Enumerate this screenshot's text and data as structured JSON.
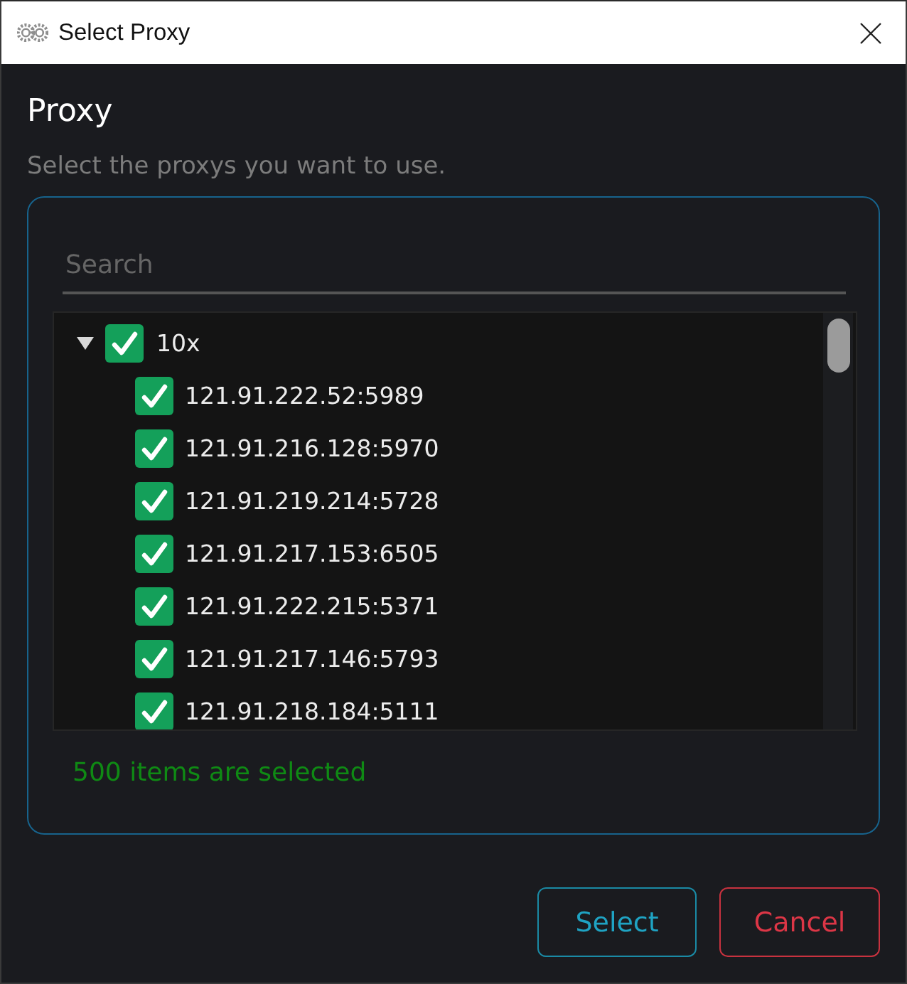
{
  "window": {
    "title": "Select Proxy"
  },
  "header": {
    "title": "Proxy",
    "subtitle": "Select the proxys you want to use."
  },
  "search": {
    "placeholder": "Search"
  },
  "tree": [
    {
      "label": "10x",
      "expanded": true,
      "checked": true,
      "children": [
        {
          "label": "121.91.222.52:5989",
          "checked": true
        },
        {
          "label": "121.91.216.128:5970",
          "checked": true
        },
        {
          "label": "121.91.219.214:5728",
          "checked": true
        },
        {
          "label": "121.91.217.153:6505",
          "checked": true
        },
        {
          "label": "121.91.222.215:5371",
          "checked": true
        },
        {
          "label": "121.91.217.146:5793",
          "checked": true
        },
        {
          "label": "121.91.218.184:5111",
          "checked": true
        }
      ]
    }
  ],
  "status": "500 items are selected",
  "buttons": [
    {
      "label": "Select",
      "kind": "primary"
    },
    {
      "label": "Cancel",
      "kind": "danger"
    }
  ]
}
